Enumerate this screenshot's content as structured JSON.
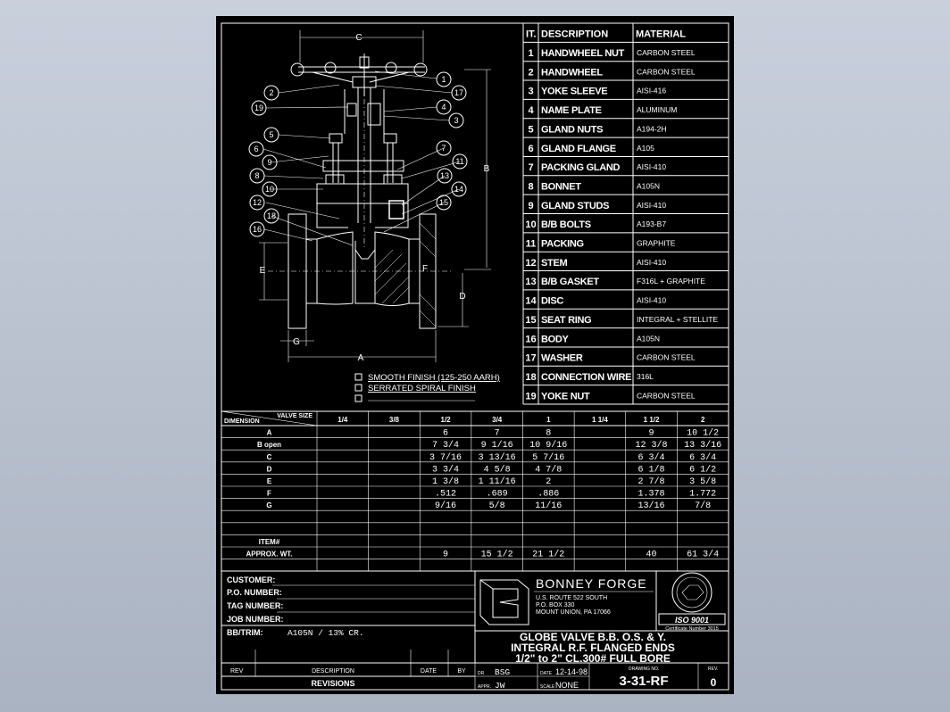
{
  "dim_letters": {
    "c": "C",
    "b": "B",
    "e": "E",
    "d": "D",
    "f": "F",
    "g": "G",
    "a": "A"
  },
  "balloons": [
    "1",
    "17",
    "2",
    "19",
    "4",
    "3",
    "5",
    "7",
    "6",
    "11",
    "9",
    "8",
    "13",
    "10",
    "14",
    "12",
    "15",
    "18",
    "16"
  ],
  "finish_options": [
    "SMOOTH FINISH (125-250 AARH)",
    "SERRATED SPIRAL FINISH",
    ""
  ],
  "parts_header": {
    "item": "IT.",
    "description": "DESCRIPTION",
    "material": "MATERIAL"
  },
  "parts": [
    {
      "item": "1",
      "description": "HANDWHEEL NUT",
      "material": "CARBON STEEL"
    },
    {
      "item": "2",
      "description": "HANDWHEEL",
      "material": "CARBON STEEL"
    },
    {
      "item": "3",
      "description": "YOKE SLEEVE",
      "material": "AISI-416"
    },
    {
      "item": "4",
      "description": "NAME PLATE",
      "material": "ALUMINUM"
    },
    {
      "item": "5",
      "description": "GLAND NUTS",
      "material": "A194-2H"
    },
    {
      "item": "6",
      "description": "GLAND FLANGE",
      "material": "A105"
    },
    {
      "item": "7",
      "description": "PACKING GLAND",
      "material": "AISI-410"
    },
    {
      "item": "8",
      "description": "BONNET",
      "material": "A105N"
    },
    {
      "item": "9",
      "description": "GLAND STUDS",
      "material": "AISI-410"
    },
    {
      "item": "10",
      "description": "B/B BOLTS",
      "material": "A193-B7"
    },
    {
      "item": "11",
      "description": "PACKING",
      "material": "GRAPHITE"
    },
    {
      "item": "12",
      "description": "STEM",
      "material": "AISI-410"
    },
    {
      "item": "13",
      "description": "B/B GASKET",
      "material": "F316L + GRAPHITE"
    },
    {
      "item": "14",
      "description": "DISC",
      "material": "AISI-410"
    },
    {
      "item": "15",
      "description": "SEAT RING",
      "material": "INTEGRAL + STELLITE"
    },
    {
      "item": "16",
      "description": "BODY",
      "material": "A105N"
    },
    {
      "item": "17",
      "description": "WASHER",
      "material": "CARBON STEEL"
    },
    {
      "item": "18",
      "description": "CONNECTION WIRE",
      "material": "316L"
    },
    {
      "item": "19",
      "description": "YOKE NUT",
      "material": "CARBON STEEL"
    }
  ],
  "dim_table": {
    "corner_top": "VALVE SIZE",
    "corner_bottom": "DIMENSION",
    "sizes": [
      "1/4",
      "3/8",
      "1/2",
      "3/4",
      "1",
      "1 1/4",
      "1 1/2",
      "2"
    ],
    "rows": [
      {
        "label": "A",
        "values": [
          "",
          "",
          "6",
          "7",
          "8",
          "",
          "9",
          "10 1/2"
        ]
      },
      {
        "label": "B open",
        "values": [
          "",
          "",
          "7 3/4",
          "9 1/16",
          "10 9/16",
          "",
          "12 3/8",
          "13 3/16"
        ]
      },
      {
        "label": "C",
        "values": [
          "",
          "",
          "3 7/16",
          "3 13/16",
          "5 7/16",
          "",
          "6 3/4",
          "6 3/4"
        ]
      },
      {
        "label": "D",
        "values": [
          "",
          "",
          "3 3/4",
          "4 5/8",
          "4 7/8",
          "",
          "6 1/8",
          "6 1/2"
        ]
      },
      {
        "label": "E",
        "values": [
          "",
          "",
          "1 3/8",
          "1 11/16",
          "2",
          "",
          "2 7/8",
          "3 5/8"
        ]
      },
      {
        "label": "F",
        "values": [
          "",
          "",
          ".512",
          ".689",
          ".886",
          "",
          "1.378",
          "1.772"
        ]
      },
      {
        "label": "G",
        "values": [
          "",
          "",
          "9/16",
          "5/8",
          "11/16",
          "",
          "13/16",
          "7/8"
        ]
      },
      {
        "label": "",
        "values": [
          "",
          "",
          "",
          "",
          "",
          "",
          "",
          ""
        ]
      },
      {
        "label": "",
        "values": [
          "",
          "",
          "",
          "",
          "",
          "",
          "",
          ""
        ]
      },
      {
        "label": "ITEM#",
        "values": [
          "",
          "",
          "",
          "",
          "",
          "",
          "",
          ""
        ]
      },
      {
        "label": "APPROX. WT.",
        "values": [
          "",
          "",
          "9",
          "15 1/2",
          "21 1/2",
          "",
          "40",
          "61 3/4"
        ]
      },
      {
        "label": "",
        "values": [
          "",
          "",
          "",
          "",
          "",
          "",
          "",
          ""
        ]
      }
    ]
  },
  "info_labels": {
    "customer": "CUSTOMER:",
    "po": "P.O. NUMBER:",
    "tag": "TAG NUMBER:",
    "job": "JOB NUMBER:",
    "bbtrim": "BB/TRIM:",
    "bbtrim_value": "A105N / 13% CR."
  },
  "company": {
    "name": "BONNEY FORGE",
    "address": [
      "U.S. ROUTE 522 SOUTH",
      "P.O. BOX 330",
      "MOUNT UNION, PA 17066"
    ],
    "iso": "ISO 9001",
    "cert": "Certificate Number 3015"
  },
  "title_lines": [
    "GLOBE VALVE B.B. O.S. & Y.",
    "INTEGRAL R.F. FLANGED ENDS",
    "1/2\" to 2\" CL.300# FULL BORE"
  ],
  "revisions": {
    "rev": "REV",
    "description": "DESCRIPTION",
    "date": "DATE",
    "by": "BY",
    "footer": "REVISIONS"
  },
  "drawn": {
    "dr_label": "DR",
    "dr": "BSG",
    "appr_label": "APPR.",
    "appr": "JW",
    "date_label": "DATE",
    "date": "12-14-98",
    "scale_label": "SCALE",
    "scale": "NONE"
  },
  "drawing": {
    "label": "DRAWING NO.",
    "number": "3-31-RF",
    "rev_label": "REV.",
    "rev": "0"
  },
  "colors": {
    "background": "#b4bccb",
    "sheet": "#000000",
    "lines": "#ffffff"
  }
}
